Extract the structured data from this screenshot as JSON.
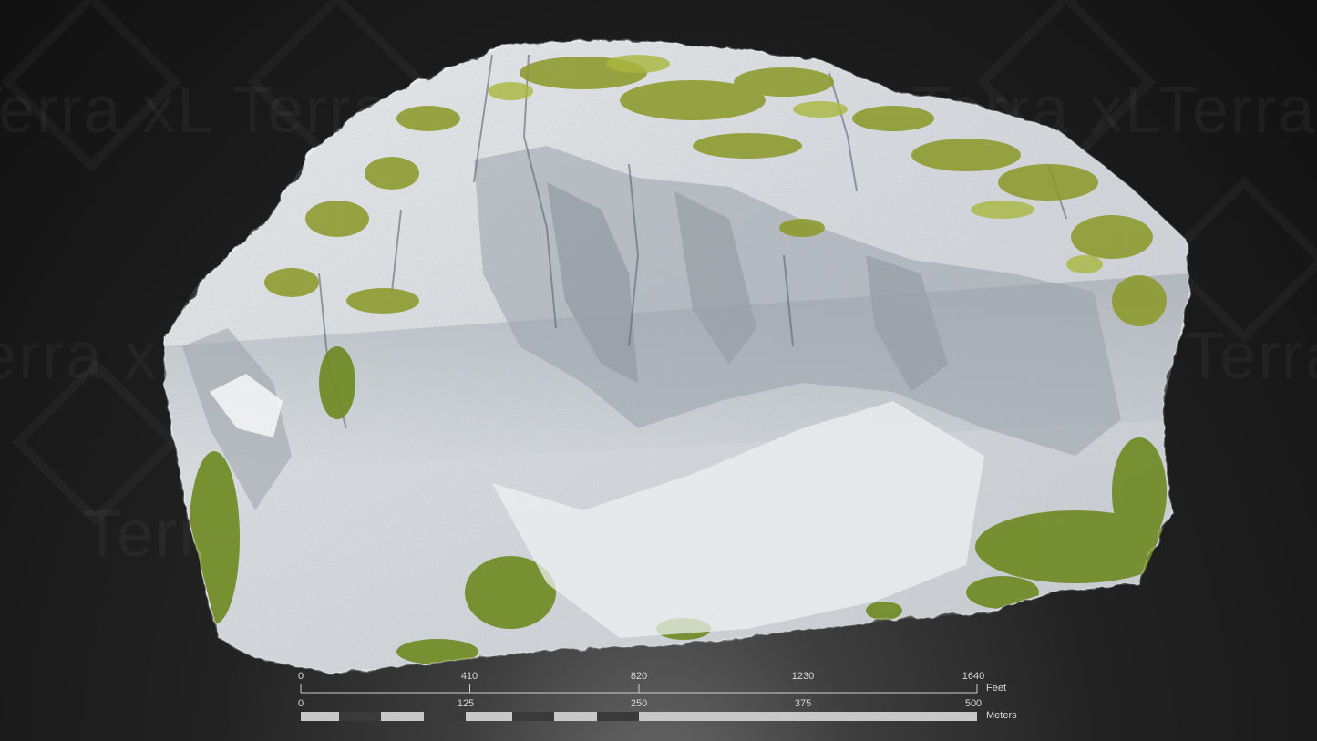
{
  "watermark": {
    "text": "Terra xL"
  },
  "scale_bar": {
    "feet": {
      "unit": "Feet",
      "ticks": [
        "0",
        "410",
        "820",
        "1230",
        "1640"
      ]
    },
    "meters": {
      "unit": "Meters",
      "ticks": [
        "0",
        "125",
        "250",
        "375",
        "500"
      ]
    }
  },
  "colors": {
    "background": "#1a1a1a",
    "rock": "#dfe3e6",
    "vegetation": "#8a9a2e",
    "scale_light": "#c8c8c8",
    "scale_dark": "#3a3a3a"
  }
}
